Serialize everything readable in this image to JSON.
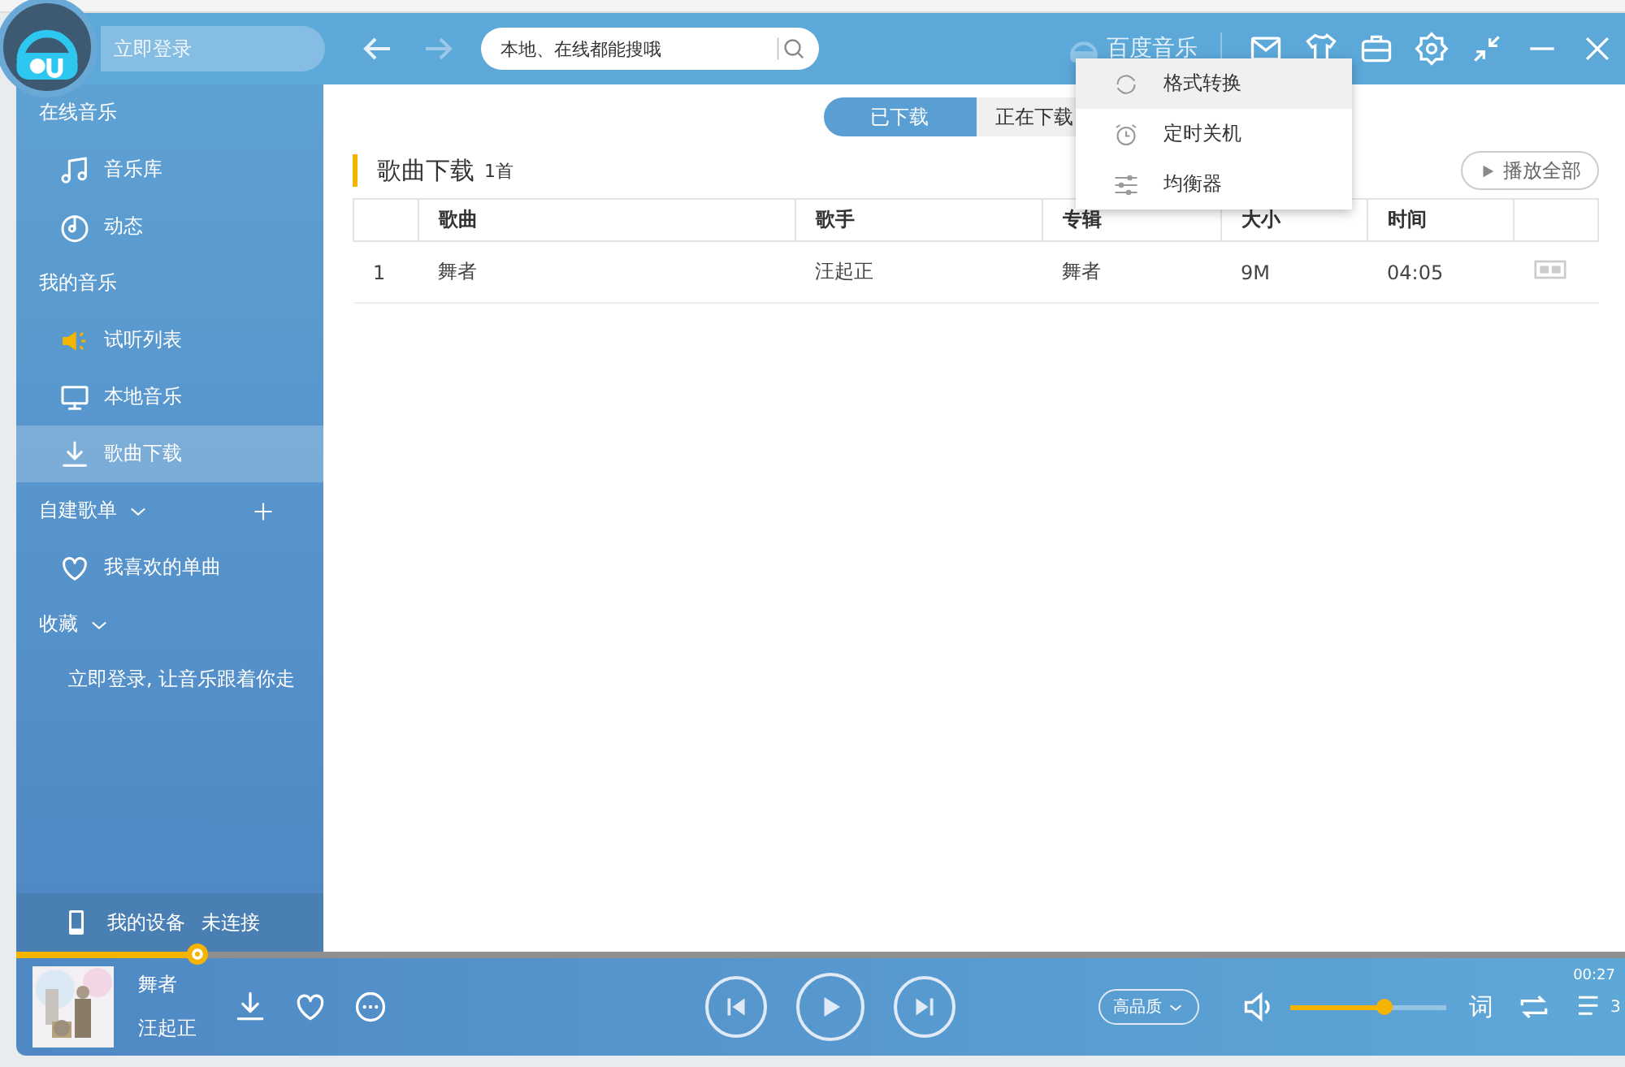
{
  "titlebar": {
    "login": "立即登录",
    "search": {
      "placeholder": "本地、在线都能搜哦"
    },
    "brand": "百度音乐"
  },
  "menu": [
    {
      "label": "格式转换",
      "selected": true
    },
    {
      "label": "定时关机",
      "selected": false
    },
    {
      "label": "均衡器",
      "selected": false
    }
  ],
  "sidebar": {
    "sections": [
      {
        "title": "在线音乐",
        "kind": "plain",
        "items": [
          {
            "label": "音乐库",
            "selected": false
          },
          {
            "label": "动态",
            "selected": false
          }
        ]
      },
      {
        "title": "我的音乐",
        "kind": "plain",
        "items": [
          {
            "label": "试听列表",
            "selected": false
          },
          {
            "label": "本地音乐",
            "selected": false
          },
          {
            "label": "歌曲下载",
            "selected": true
          }
        ]
      },
      {
        "title": "自建歌单",
        "kind": "addable",
        "items": [
          {
            "label": "我喜欢的单曲",
            "selected": false
          }
        ]
      },
      {
        "title": "收藏",
        "kind": "collapsible",
        "hint": "立即登录, 让音乐跟着你走"
      }
    ],
    "device": {
      "label": "我的设备",
      "status": "未连接"
    }
  },
  "tabs": [
    {
      "label": "已下载",
      "selected": true
    },
    {
      "label": "正在下载",
      "selected": false
    }
  ],
  "heading": {
    "title": "歌曲下载",
    "count": "1首",
    "play_all": "播放全部"
  },
  "table": {
    "columns": [
      "",
      "歌曲",
      "歌手",
      "专辑",
      "大小",
      "时间",
      ""
    ],
    "rows": [
      [
        "1",
        "舞者",
        "汪起正",
        "舞者",
        "9M",
        "04:05"
      ]
    ]
  },
  "player": {
    "progress": {
      "level": 0.112
    },
    "song": "舞者",
    "artist": "汪起正",
    "quality": "高品质",
    "volume": {
      "level": 0.6
    },
    "lyrics": "词",
    "queue_count": "3",
    "elapsed": "00:27"
  }
}
